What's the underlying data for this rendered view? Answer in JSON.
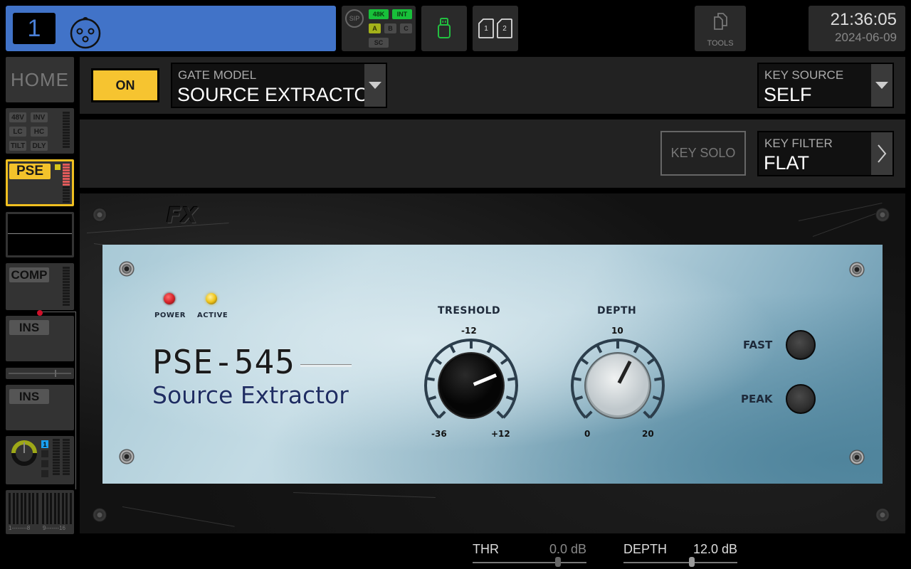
{
  "topbar": {
    "channel_number": "1",
    "channel_color": "#4173c8",
    "input_icon": "xlr-input-icon",
    "status": {
      "sip_label": "SIP",
      "sample_rate": "48K",
      "clock_source": "INT",
      "banks": [
        "A",
        "B",
        "C"
      ],
      "active_bank": "A",
      "sc_label": "SC"
    },
    "usb_icon": "usb-drive-icon",
    "sd_cards": [
      "1",
      "2"
    ],
    "tools_label": "TOOLS",
    "clock": {
      "time": "21:36:05",
      "date": "2024-06-09"
    }
  },
  "sidebar": {
    "home_label": "HOME",
    "input_tags": [
      "48V",
      "INV",
      "LC",
      "HC",
      "TILT",
      "DLY"
    ],
    "gate_label": "PSE",
    "gate_meter_active_segments": 8,
    "comp_label": "COMP",
    "insert1_label": "INS",
    "insert2_label": "INS",
    "pan_bus_badge": "1",
    "bus_range_labels": [
      "1--------8",
      "9-------16"
    ]
  },
  "header": {
    "on_label": "ON",
    "gate_model": {
      "label": "GATE MODEL",
      "value": "SOURCE EXTRACTOR"
    },
    "key_source": {
      "label": "KEY SOURCE",
      "value": "SELF"
    },
    "key_solo_label": "KEY SOLO",
    "key_filter": {
      "label": "KEY FILTER",
      "value": "FLAT"
    }
  },
  "plugin": {
    "brand_logo": "FX",
    "model_name": "PSE-545",
    "model_subtitle": "Source Extractor",
    "leds": [
      {
        "label": "POWER",
        "color": "#d8262c"
      },
      {
        "label": "ACTIVE",
        "color": "#f0c418"
      }
    ],
    "threshold_knob": {
      "title": "TRESHOLD",
      "top_label": "-12",
      "min_label": "-36",
      "max_label": "+12",
      "min": -36,
      "max": 12,
      "value": 0
    },
    "depth_knob": {
      "title": "DEPTH",
      "top_label": "10",
      "min_label": "0",
      "max_label": "20",
      "min": 0,
      "max": 20,
      "value": 12
    },
    "switches": [
      "FAST",
      "PEAK"
    ]
  },
  "params": [
    {
      "name": "THR",
      "value": "0.0 dB",
      "fraction": 0.75
    },
    {
      "name": "DEPTH",
      "value": "12.0 dB",
      "fraction": 0.6
    }
  ]
}
